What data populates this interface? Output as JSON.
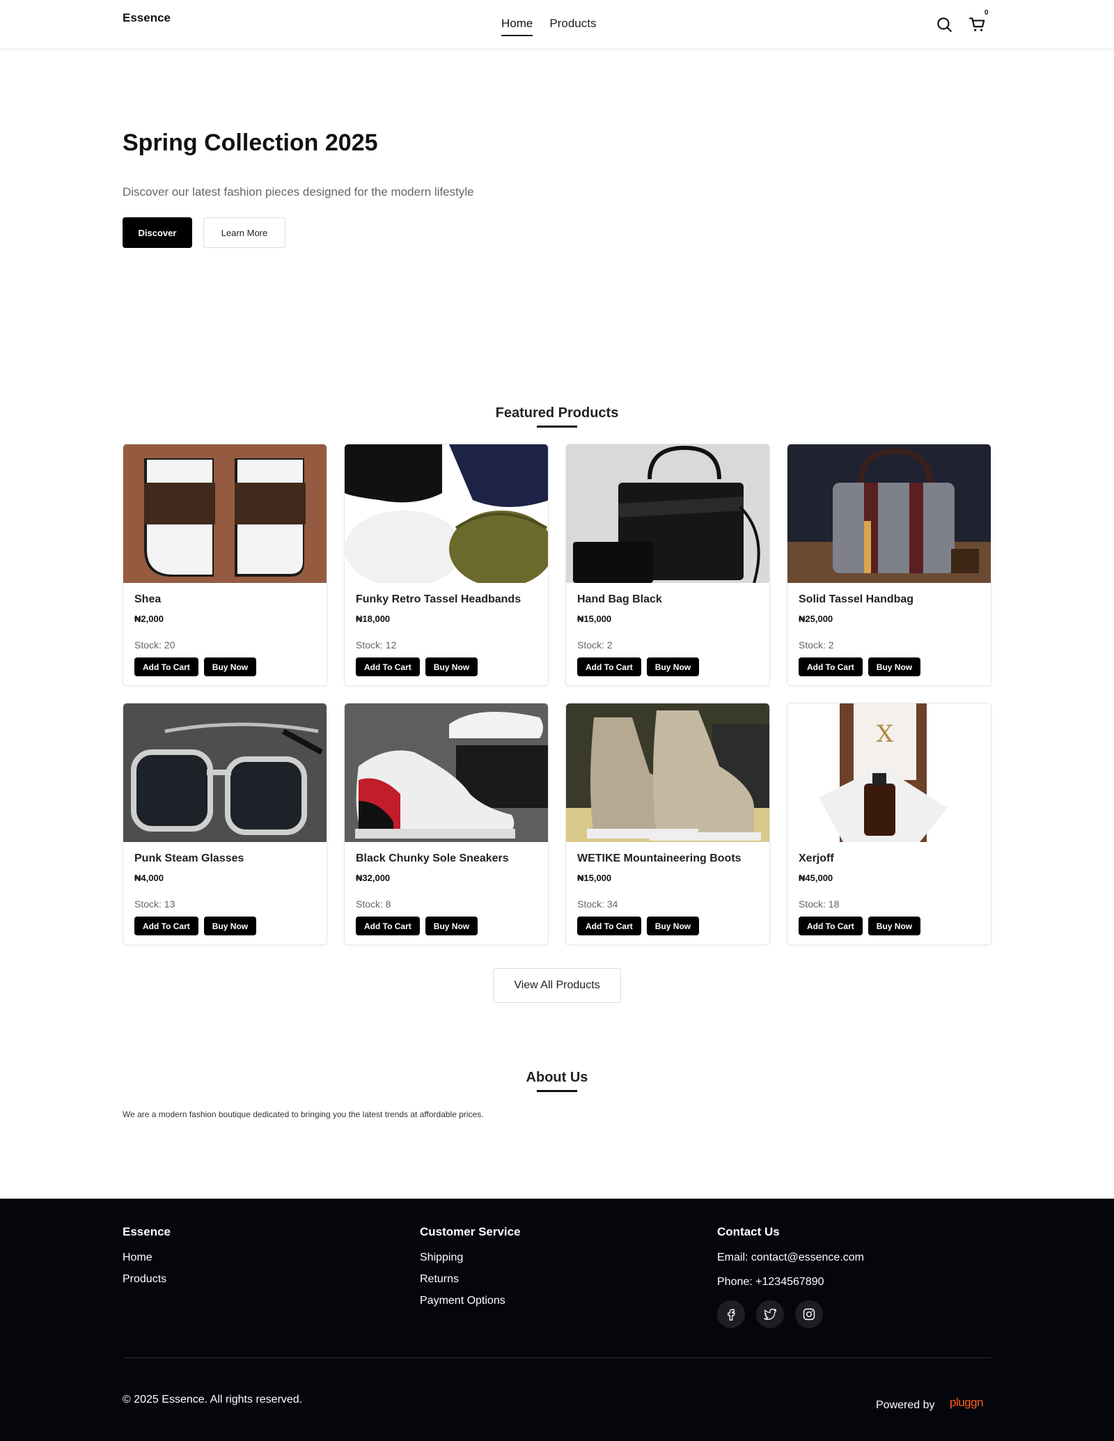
{
  "header": {
    "brand": "Essence",
    "nav": [
      {
        "label": "Home",
        "active": true
      },
      {
        "label": "Products",
        "active": false
      }
    ],
    "cart_count": "0",
    "icons": [
      "search-icon",
      "cart-icon"
    ]
  },
  "hero": {
    "title": "Spring Collection 2025",
    "subtitle": "Discover our latest fashion pieces designed for the modern lifestyle",
    "primary_button": "Discover",
    "secondary_button": "Learn More"
  },
  "featured": {
    "title": "Featured Products",
    "add_to_cart_label": "Add To Cart",
    "buy_now_label": "Buy Now",
    "products": [
      {
        "name": "Shea",
        "price": "₦2,000",
        "stock": "Stock: 20"
      },
      {
        "name": "Funky Retro Tassel Headbands",
        "price": "₦18,000",
        "stock": "Stock: 12"
      },
      {
        "name": "Hand Bag Black",
        "price": "₦15,000",
        "stock": "Stock: 2"
      },
      {
        "name": "Solid Tassel Handbag",
        "price": "₦25,000",
        "stock": "Stock: 2"
      },
      {
        "name": "Punk Steam Glasses",
        "price": "₦4,000",
        "stock": "Stock: 13"
      },
      {
        "name": "Black Chunky Sole Sneakers",
        "price": "₦32,000",
        "stock": "Stock: 8"
      },
      {
        "name": "WETIKE Mountaineering Boots",
        "price": "₦15,000",
        "stock": "Stock: 34"
      },
      {
        "name": "Xerjoff",
        "price": "₦45,000",
        "stock": "Stock: 18"
      }
    ],
    "view_all_button": "View All Products"
  },
  "about": {
    "title": "About Us",
    "text": "We are a modern fashion boutique dedicated to bringing you the latest trends at affordable prices."
  },
  "footer": {
    "col1": {
      "title": "Essence",
      "links": [
        "Home",
        "Products"
      ]
    },
    "col2": {
      "title": "Customer Service",
      "links": [
        "Shipping",
        "Returns",
        "Payment Options"
      ]
    },
    "col3": {
      "title": "Contact Us",
      "email": "Email: contact@essence.com",
      "phone": "Phone: +1234567890",
      "social": [
        "facebook-icon",
        "twitter-icon",
        "instagram-icon"
      ]
    },
    "copyright": "© 2025 Essence. All rights reserved.",
    "powered_by": "Powered by",
    "powered_brand": "pluggn",
    "accent_color": "#ff5a1f"
  }
}
